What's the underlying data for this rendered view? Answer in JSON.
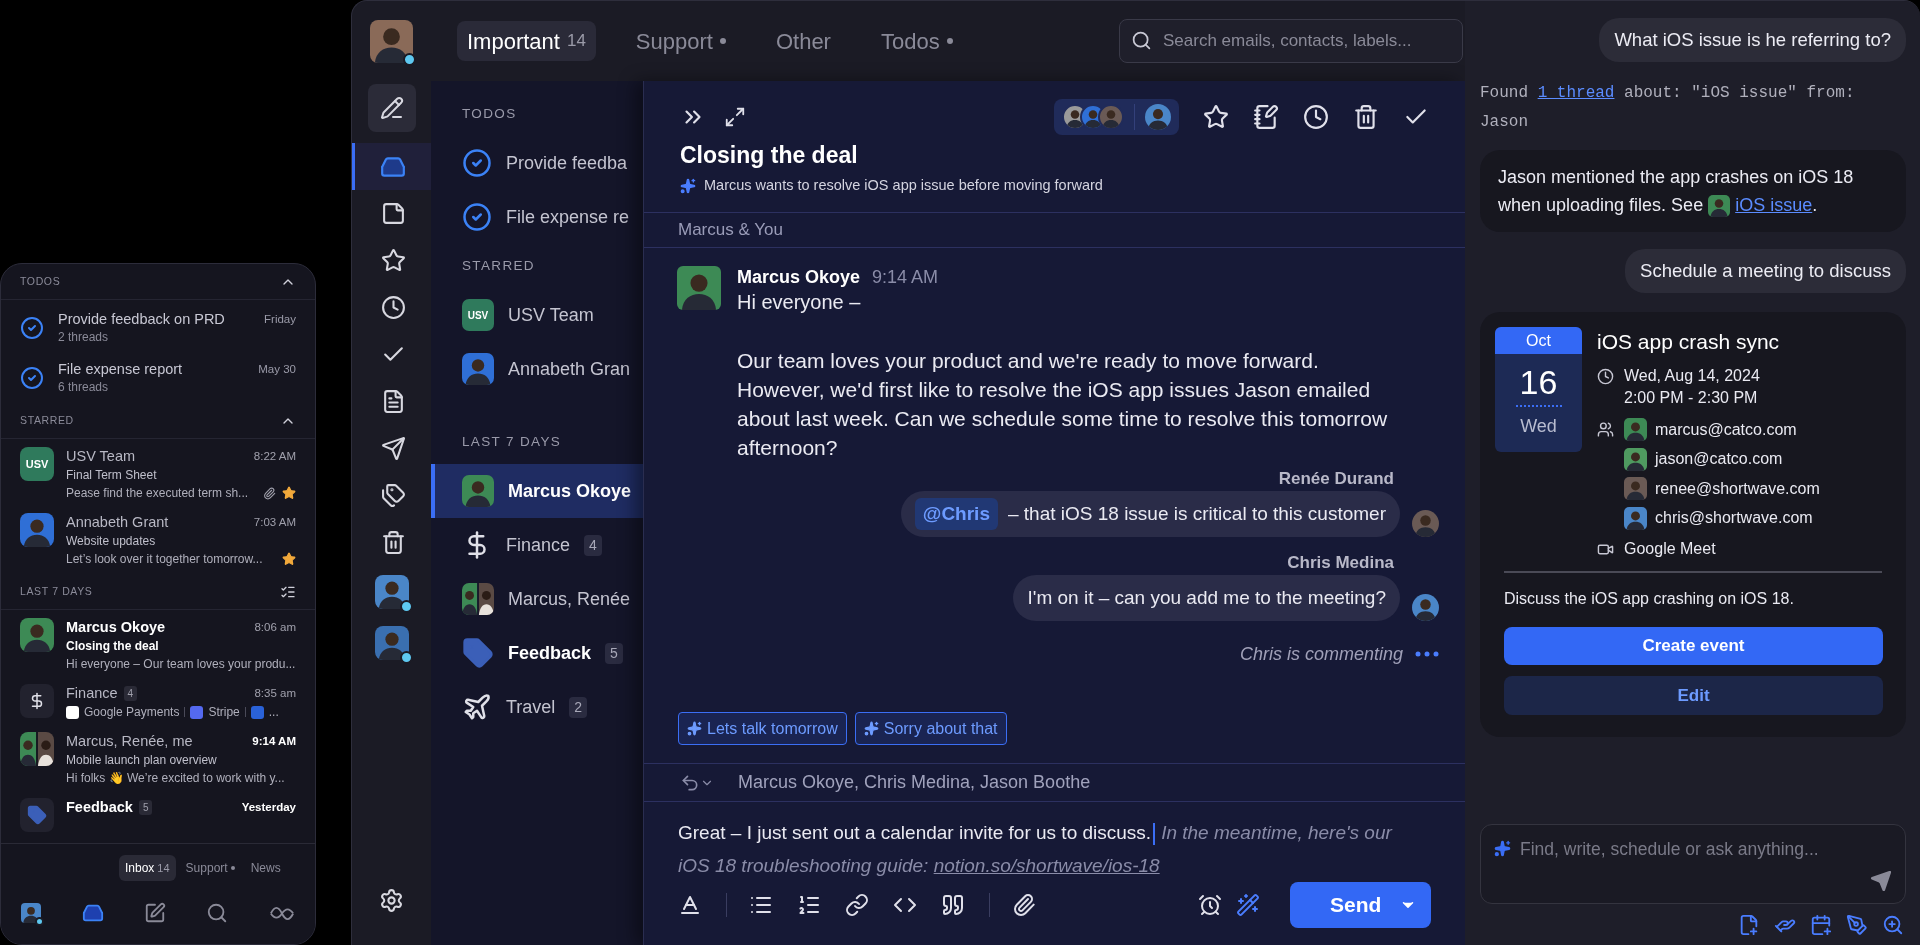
{
  "mobile": {
    "sections": [
      {
        "kind": "todos",
        "heading": "TODOS",
        "items": [
          {
            "title": "Provide feedback on PRD",
            "meta": "2 threads",
            "date": "Friday"
          },
          {
            "title": "File expense report",
            "meta": "6 threads",
            "date": "May 30"
          }
        ]
      },
      {
        "kind": "starred",
        "heading": "STARRED",
        "items": [
          {
            "sender": "USV Team",
            "time": "8:22 AM",
            "subject": "Final Term Sheet",
            "preview": "Pease find the executed term sh...",
            "unread": false,
            "time_bold": false,
            "attachment": true,
            "starred": true,
            "avatar": {
              "kind": "initials",
              "text": "USV",
              "color": "#2f7a5c"
            }
          },
          {
            "sender": "Annabeth Grant",
            "time": "7:03 AM",
            "subject": "Website updates",
            "preview": "Let’s look over it together tomorrow...",
            "unread": false,
            "time_bold": false,
            "attachment": false,
            "starred": true,
            "avatar": {
              "kind": "person",
              "color": "#2f6fd6"
            }
          }
        ]
      },
      {
        "kind": "recent",
        "heading": "LAST 7 DAYS",
        "items": [
          {
            "sender": "Marcus Okoye",
            "time": "8:06 am",
            "subject": "Closing the deal",
            "preview": "Hi everyone – Our team loves your produ...",
            "unread": true,
            "time_bold": false,
            "attachment": false,
            "starred": false,
            "avatar": {
              "kind": "person",
              "color": "#3d8a55"
            }
          },
          {
            "sender": "Finance",
            "count": "4",
            "time": "8:35 am",
            "senders": [
              {
                "name": "Google Payments",
                "color": "#ffffff"
              },
              {
                "name": "Stripe",
                "color": "#5469f0"
              },
              {
                "name": "...",
                "color": "#2a62d8"
              }
            ],
            "unread": false,
            "time_bold": false,
            "avatar": {
              "kind": "dollar"
            }
          },
          {
            "sender": "Marcus, Renée, me",
            "time": "9:14 AM",
            "subject": "Mobile launch plan overview",
            "preview": "Hi folks 👋 We’re excited to work with y...",
            "unread": false,
            "time_bold": true,
            "attachment": false,
            "starred": false,
            "avatar": {
              "kind": "pair"
            }
          },
          {
            "sender": "Feedback",
            "count": "5",
            "time": "Yesterday",
            "unread": true,
            "time_bold": true,
            "avatar": {
              "kind": "label"
            }
          }
        ]
      }
    ],
    "tabs": [
      {
        "label": "Inbox",
        "count": "14",
        "dot": false,
        "selected": true
      },
      {
        "label": "Support",
        "dot": true,
        "selected": false
      },
      {
        "label": "News",
        "dot": false,
        "selected": false
      }
    ],
    "bottom_nav": [
      {
        "kind": "account",
        "selected": false
      },
      {
        "kind": "inbox",
        "selected": true
      },
      {
        "kind": "compose",
        "selected": false
      },
      {
        "kind": "search",
        "selected": false
      },
      {
        "kind": "logo",
        "selected": false
      }
    ]
  },
  "app": {
    "account": {
      "color": "#8a6a58",
      "online": true
    },
    "tabs": [
      {
        "label": "Important",
        "count": "14",
        "dot": false,
        "selected": true
      },
      {
        "label": "Support",
        "dot": true,
        "selected": false
      },
      {
        "label": "Other",
        "dot": false,
        "selected": false
      },
      {
        "label": "Todos",
        "dot": true,
        "selected": false
      }
    ],
    "search": {
      "placeholder": "Search emails, contacts, labels..."
    },
    "rail": [
      {
        "kind": "compose",
        "selected": false
      },
      {
        "kind": "inbox",
        "selected": true
      },
      {
        "kind": "notes",
        "selected": false
      },
      {
        "kind": "starred",
        "selected": false
      },
      {
        "kind": "snoozed",
        "selected": false
      },
      {
        "kind": "done",
        "selected": false
      },
      {
        "kind": "drafts",
        "selected": false
      },
      {
        "kind": "sent",
        "selected": false
      },
      {
        "kind": "labels",
        "selected": false
      },
      {
        "kind": "trash",
        "selected": false
      },
      {
        "kind": "account",
        "color": "#4a86c8",
        "selected": false
      },
      {
        "kind": "account",
        "color": "#3a6fb0",
        "selected": false
      }
    ],
    "folders": [
      {
        "heading": "TODOS",
        "items": [
          {
            "kind": "todo",
            "label": "Provide feedba",
            "unread": false,
            "selected": false
          },
          {
            "kind": "todo",
            "label": "File expense re",
            "unread": false,
            "selected": false
          }
        ]
      },
      {
        "heading": "STARRED",
        "items": [
          {
            "kind": "initials",
            "avatar_text": "USV",
            "color": "#2f7a5c",
            "label": "USV Team",
            "unread": false,
            "selected": false
          },
          {
            "kind": "person",
            "color": "#2f6fd6",
            "label": "Annabeth Gran",
            "unread": false,
            "selected": false
          }
        ]
      },
      {
        "heading": "LAST 7 DAYS",
        "items": [
          {
            "kind": "person",
            "color": "#3d8a55",
            "label": "Marcus Okoye",
            "unread": true,
            "selected": true
          },
          {
            "kind": "dollar",
            "label": "Finance",
            "count": "4",
            "unread": false,
            "selected": false
          },
          {
            "kind": "pair",
            "label": "Marcus, Renée",
            "unread": false,
            "selected": false
          },
          {
            "kind": "label",
            "label": "Feedback",
            "count": "5",
            "unread": true,
            "selected": false
          },
          {
            "kind": "plane",
            "label": "Travel",
            "count": "2",
            "unread": false,
            "selected": false
          }
        ]
      }
    ],
    "thread": {
      "title": "Closing the deal",
      "summary": "Marcus wants to resolve iOS app issue before moving forward",
      "participants": [
        {
          "color": "#9a9a9a"
        },
        {
          "color": "#2f6fd6"
        },
        {
          "color": "#6a5a55"
        }
      ],
      "assignee": {
        "color": "#4a86c8"
      },
      "group_label": "Marcus & You",
      "message": {
        "sender": "Marcus Okoye",
        "time": "9:14 AM",
        "color": "#3d8a55",
        "greeting": "Hi everyone –",
        "body": "Our team loves your product and we're ready to move forward. However, we'd first like to resolve the iOS app issues Jason emailed about last week. Can we schedule some time to resolve this tomorrow afternoon?"
      },
      "comments": [
        {
          "author": "Renée Durand",
          "mention": "@Chris",
          "text": "– that iOS 18 issue is critical to this customer",
          "color": "#6a5a55"
        },
        {
          "author": "Chris Medina",
          "text": "I'm on it – can you add me to the meeting?",
          "color": "#4a86c8"
        }
      ],
      "typing": "Chris is commenting",
      "suggestions": [
        "Lets talk tomorrow",
        "Sorry about that"
      ],
      "recipients": "Marcus Okoye, Chris Medina, Jason Boothe",
      "draft": {
        "text": "Great – I just sent out a calendar invite for us to discuss.",
        "suggestion": "In the meantime, here's our iOS 18 troubleshooting guide:",
        "link": "notion.so/shortwave/ios-18"
      },
      "send": "Send"
    }
  },
  "chat": {
    "messages": [
      {
        "kind": "user",
        "text": "What iOS issue is he referring to?"
      },
      {
        "kind": "search",
        "prefix": "Found",
        "link": "1 thread",
        "suffix": "about: \"iOS issue\" from: Jason"
      },
      {
        "kind": "answer",
        "text": "Jason mentioned the app crashes on iOS 18 when uploading files. See",
        "avatar": {
          "color": "#3d8a55"
        },
        "link": "iOS issue",
        "end": "."
      },
      {
        "kind": "user",
        "text": "Schedule a meeting to discuss"
      },
      {
        "kind": "event",
        "month": "Oct",
        "day": "16",
        "weekday": "Wed",
        "title": "iOS app crash sync",
        "date": "Wed, Aug 14, 2024",
        "time": "2:00 PM - 2:30 PM",
        "attendees": [
          {
            "email": "marcus@catco.com",
            "color": "#3d8a55"
          },
          {
            "email": "jason@catco.com",
            "color": "#4f9a60"
          },
          {
            "email": "renee@shortwave.com",
            "color": "#6a5a55"
          },
          {
            "email": "chris@shortwave.com",
            "color": "#4a86c8"
          }
        ],
        "location": "Google Meet",
        "description": "Discuss the iOS app crashing on iOS 18.",
        "primary": "Create event",
        "secondary": "Edit"
      }
    ],
    "input": {
      "placeholder": "Find, write, schedule or ask anything..."
    }
  }
}
